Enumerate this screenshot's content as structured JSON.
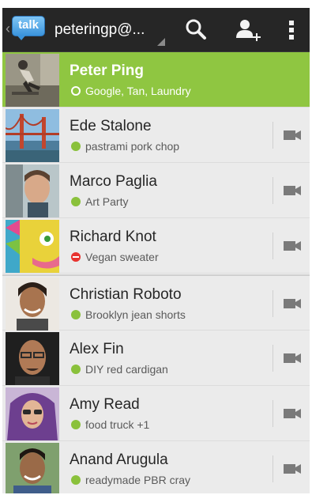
{
  "app": {
    "logo_text": "talk",
    "logo_icon": "talk-bubble-icon"
  },
  "header": {
    "account": "peteringp@...",
    "icons": [
      "search-icon",
      "add-contact-icon",
      "overflow-menu-icon"
    ]
  },
  "colors": {
    "accent": "#8fc641",
    "available": "#8ac13b",
    "busy": "#e8332f",
    "bar": "#262626"
  },
  "contacts": [
    {
      "name": "Peter Ping",
      "status": "Google, Tan, Laundry",
      "presence": "self",
      "selected": true
    },
    {
      "name": "Ede Stalone",
      "status": "pastrami pork chop",
      "presence": "available",
      "video_icon": "video-camera-icon"
    },
    {
      "name": "Marco Paglia",
      "status": "Art Party",
      "presence": "available",
      "video_icon": "video-camera-icon"
    },
    {
      "name": "Richard Knot",
      "status": "Vegan sweater",
      "presence": "busy",
      "video_icon": "video-camera-icon"
    },
    {
      "name": "Christian Roboto",
      "status": "Brooklyn jean shorts",
      "presence": "available",
      "video_icon": "video-camera-icon"
    },
    {
      "name": "Alex Fin",
      "status": "DIY red cardigan",
      "presence": "available",
      "video_icon": "video-camera-icon"
    },
    {
      "name": "Amy Read",
      "status": "food truck +1",
      "presence": "available",
      "video_icon": "video-camera-icon"
    },
    {
      "name": "Anand Arugula",
      "status": "readymade PBR cray",
      "presence": "available",
      "video_icon": "video-camera-icon"
    }
  ]
}
